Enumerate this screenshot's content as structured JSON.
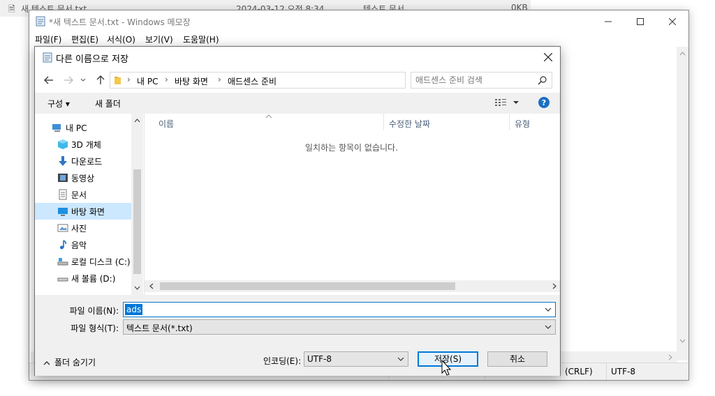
{
  "background_explorer": {
    "file_name": "새 텍스트 문서.txt",
    "date": "2024-03-12 오전 8:34",
    "type": "텍스트 문서",
    "size": "0KB"
  },
  "notepad": {
    "title": "*새 텍스트 문서.txt - Windows 메모장",
    "menu": [
      "파일(F)",
      "편집(E)",
      "서식(O)",
      "보기(V)",
      "도움말(H)"
    ],
    "status": {
      "line_ending": "(CRLF)",
      "encoding": "UTF-8"
    }
  },
  "dialog": {
    "title": "다른 이름으로 저장",
    "breadcrumb": [
      "내 PC",
      "바탕 화면",
      "애드센스 준비"
    ],
    "search_placeholder": "애드센스 준비 검색",
    "toolbar": {
      "organize": "구성 ▾",
      "new_folder": "새 폴더"
    },
    "nav_items": [
      {
        "label": "내 PC",
        "icon": "pc-icon"
      },
      {
        "label": "3D 개체",
        "icon": "cube-icon"
      },
      {
        "label": "다운로드",
        "icon": "download-icon"
      },
      {
        "label": "동영상",
        "icon": "film-icon"
      },
      {
        "label": "문서",
        "icon": "document-icon"
      },
      {
        "label": "바탕 화면",
        "icon": "desktop-icon",
        "selected": true
      },
      {
        "label": "사진",
        "icon": "picture-icon"
      },
      {
        "label": "음악",
        "icon": "music-icon"
      },
      {
        "label": "로컬 디스크 (C:)",
        "icon": "drive-icon"
      },
      {
        "label": "새 볼륨 (D:)",
        "icon": "drive-icon"
      }
    ],
    "columns": [
      "이름",
      "수정한 날짜",
      "유형"
    ],
    "empty_message": "일치하는 항목이 없습니다.",
    "filename_label": "파일 이름(N):",
    "filename_value": "ads",
    "filetype_label": "파일 형식(T):",
    "filetype_value": "텍스트 문서(*.txt)",
    "hide_folders": "폴더 숨기기",
    "encoding_label": "인코딩(E):",
    "encoding_value": "UTF-8",
    "save_button": "저장(S)",
    "cancel_button": "취소"
  },
  "colors": {
    "accent": "#0078d7",
    "selected_nav": "#cce8ff",
    "dialog_bg": "#f0f0f0"
  }
}
